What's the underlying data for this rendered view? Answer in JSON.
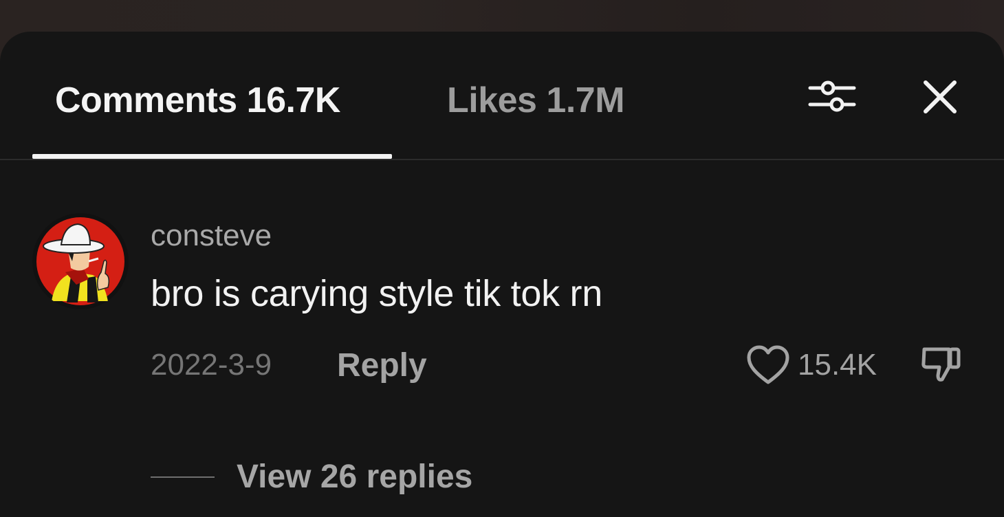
{
  "tabs": {
    "comments_label": "Comments 16.7K",
    "likes_label": "Likes 1.7M"
  },
  "header_icons": {
    "filter": "sliders-icon",
    "close": "close-icon"
  },
  "comment": {
    "username": "consteve",
    "text": "bro is carying style tik tok rn",
    "date": "2022-3-9",
    "reply_label": "Reply",
    "like_count": "15.4K",
    "view_replies_label": "View 26 replies",
    "icons": {
      "like": "heart-outline-icon",
      "dislike": "thumbs-down-icon",
      "avatar": "cowboy-avatar"
    }
  },
  "colors": {
    "sheet_background": "#151515",
    "active_tab": "#f4f4f4",
    "inactive_tab": "#9d9d9d",
    "avatar_ring": "#d41f14"
  }
}
